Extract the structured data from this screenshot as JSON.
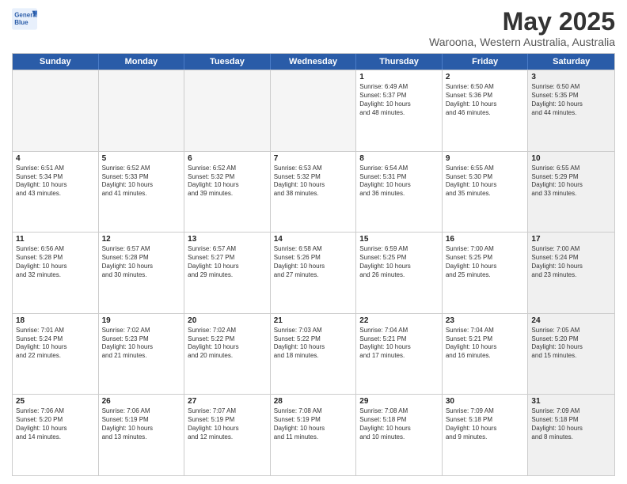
{
  "header": {
    "logo_line1": "General",
    "logo_line2": "Blue",
    "title": "May 2025",
    "location": "Waroona, Western Australia, Australia"
  },
  "weekdays": [
    "Sunday",
    "Monday",
    "Tuesday",
    "Wednesday",
    "Thursday",
    "Friday",
    "Saturday"
  ],
  "rows": [
    [
      {
        "day": "",
        "info": "",
        "empty": true
      },
      {
        "day": "",
        "info": "",
        "empty": true
      },
      {
        "day": "",
        "info": "",
        "empty": true
      },
      {
        "day": "",
        "info": "",
        "empty": true
      },
      {
        "day": "1",
        "info": "Sunrise: 6:49 AM\nSunset: 5:37 PM\nDaylight: 10 hours\nand 48 minutes.",
        "shaded": false
      },
      {
        "day": "2",
        "info": "Sunrise: 6:50 AM\nSunset: 5:36 PM\nDaylight: 10 hours\nand 46 minutes.",
        "shaded": false
      },
      {
        "day": "3",
        "info": "Sunrise: 6:50 AM\nSunset: 5:35 PM\nDaylight: 10 hours\nand 44 minutes.",
        "shaded": true
      }
    ],
    [
      {
        "day": "4",
        "info": "Sunrise: 6:51 AM\nSunset: 5:34 PM\nDaylight: 10 hours\nand 43 minutes.",
        "shaded": false
      },
      {
        "day": "5",
        "info": "Sunrise: 6:52 AM\nSunset: 5:33 PM\nDaylight: 10 hours\nand 41 minutes.",
        "shaded": false
      },
      {
        "day": "6",
        "info": "Sunrise: 6:52 AM\nSunset: 5:32 PM\nDaylight: 10 hours\nand 39 minutes.",
        "shaded": false
      },
      {
        "day": "7",
        "info": "Sunrise: 6:53 AM\nSunset: 5:32 PM\nDaylight: 10 hours\nand 38 minutes.",
        "shaded": false
      },
      {
        "day": "8",
        "info": "Sunrise: 6:54 AM\nSunset: 5:31 PM\nDaylight: 10 hours\nand 36 minutes.",
        "shaded": false
      },
      {
        "day": "9",
        "info": "Sunrise: 6:55 AM\nSunset: 5:30 PM\nDaylight: 10 hours\nand 35 minutes.",
        "shaded": false
      },
      {
        "day": "10",
        "info": "Sunrise: 6:55 AM\nSunset: 5:29 PM\nDaylight: 10 hours\nand 33 minutes.",
        "shaded": true
      }
    ],
    [
      {
        "day": "11",
        "info": "Sunrise: 6:56 AM\nSunset: 5:28 PM\nDaylight: 10 hours\nand 32 minutes.",
        "shaded": false
      },
      {
        "day": "12",
        "info": "Sunrise: 6:57 AM\nSunset: 5:28 PM\nDaylight: 10 hours\nand 30 minutes.",
        "shaded": false
      },
      {
        "day": "13",
        "info": "Sunrise: 6:57 AM\nSunset: 5:27 PM\nDaylight: 10 hours\nand 29 minutes.",
        "shaded": false
      },
      {
        "day": "14",
        "info": "Sunrise: 6:58 AM\nSunset: 5:26 PM\nDaylight: 10 hours\nand 27 minutes.",
        "shaded": false
      },
      {
        "day": "15",
        "info": "Sunrise: 6:59 AM\nSunset: 5:25 PM\nDaylight: 10 hours\nand 26 minutes.",
        "shaded": false
      },
      {
        "day": "16",
        "info": "Sunrise: 7:00 AM\nSunset: 5:25 PM\nDaylight: 10 hours\nand 25 minutes.",
        "shaded": false
      },
      {
        "day": "17",
        "info": "Sunrise: 7:00 AM\nSunset: 5:24 PM\nDaylight: 10 hours\nand 23 minutes.",
        "shaded": true
      }
    ],
    [
      {
        "day": "18",
        "info": "Sunrise: 7:01 AM\nSunset: 5:24 PM\nDaylight: 10 hours\nand 22 minutes.",
        "shaded": false
      },
      {
        "day": "19",
        "info": "Sunrise: 7:02 AM\nSunset: 5:23 PM\nDaylight: 10 hours\nand 21 minutes.",
        "shaded": false
      },
      {
        "day": "20",
        "info": "Sunrise: 7:02 AM\nSunset: 5:22 PM\nDaylight: 10 hours\nand 20 minutes.",
        "shaded": false
      },
      {
        "day": "21",
        "info": "Sunrise: 7:03 AM\nSunset: 5:22 PM\nDaylight: 10 hours\nand 18 minutes.",
        "shaded": false
      },
      {
        "day": "22",
        "info": "Sunrise: 7:04 AM\nSunset: 5:21 PM\nDaylight: 10 hours\nand 17 minutes.",
        "shaded": false
      },
      {
        "day": "23",
        "info": "Sunrise: 7:04 AM\nSunset: 5:21 PM\nDaylight: 10 hours\nand 16 minutes.",
        "shaded": false
      },
      {
        "day": "24",
        "info": "Sunrise: 7:05 AM\nSunset: 5:20 PM\nDaylight: 10 hours\nand 15 minutes.",
        "shaded": true
      }
    ],
    [
      {
        "day": "25",
        "info": "Sunrise: 7:06 AM\nSunset: 5:20 PM\nDaylight: 10 hours\nand 14 minutes.",
        "shaded": false
      },
      {
        "day": "26",
        "info": "Sunrise: 7:06 AM\nSunset: 5:19 PM\nDaylight: 10 hours\nand 13 minutes.",
        "shaded": false
      },
      {
        "day": "27",
        "info": "Sunrise: 7:07 AM\nSunset: 5:19 PM\nDaylight: 10 hours\nand 12 minutes.",
        "shaded": false
      },
      {
        "day": "28",
        "info": "Sunrise: 7:08 AM\nSunset: 5:19 PM\nDaylight: 10 hours\nand 11 minutes.",
        "shaded": false
      },
      {
        "day": "29",
        "info": "Sunrise: 7:08 AM\nSunset: 5:18 PM\nDaylight: 10 hours\nand 10 minutes.",
        "shaded": false
      },
      {
        "day": "30",
        "info": "Sunrise: 7:09 AM\nSunset: 5:18 PM\nDaylight: 10 hours\nand 9 minutes.",
        "shaded": false
      },
      {
        "day": "31",
        "info": "Sunrise: 7:09 AM\nSunset: 5:18 PM\nDaylight: 10 hours\nand 8 minutes.",
        "shaded": true
      }
    ]
  ]
}
